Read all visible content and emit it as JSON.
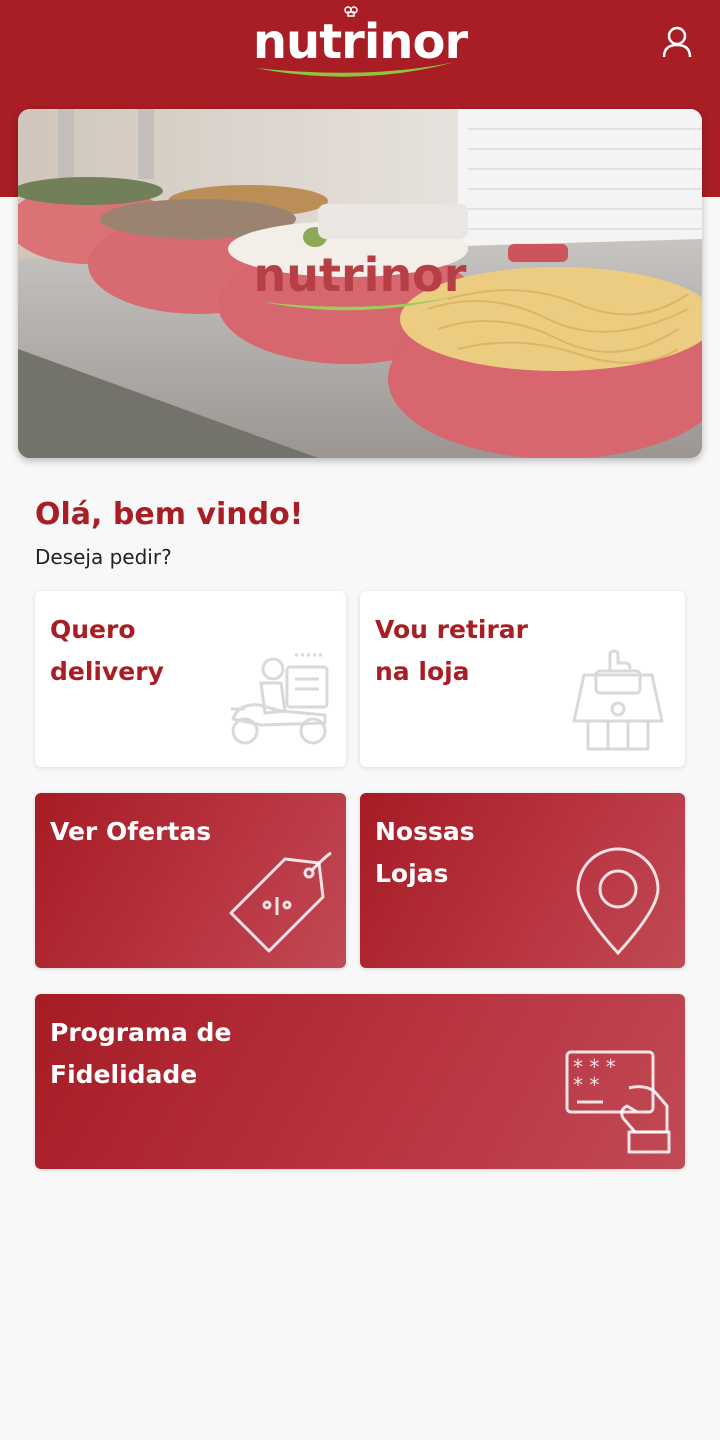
{
  "header": {
    "brand": "nutrinor",
    "profile_icon": "user-icon",
    "colors": {
      "brand_red": "#a81e24",
      "brand_green": "#8cc63f"
    }
  },
  "hero": {
    "brand_overlay": "nutrinor",
    "description_icon": "buffet-photo"
  },
  "welcome": {
    "greeting": "Olá, bem vindo!",
    "question": "Deseja pedir?"
  },
  "actions": {
    "delivery": {
      "title": "Quero\ndelivery",
      "icon": "delivery-scooter-icon"
    },
    "pickup": {
      "title": "Vou retirar\nna loja",
      "icon": "store-pickup-icon"
    },
    "offers": {
      "title": "Ver Ofertas",
      "icon": "price-tag-icon"
    },
    "stores": {
      "title": "Nossas\nLojas",
      "icon": "map-pin-icon"
    },
    "loyalty": {
      "title": "Programa de\nFidelidade",
      "icon": "loyalty-card-icon"
    }
  }
}
